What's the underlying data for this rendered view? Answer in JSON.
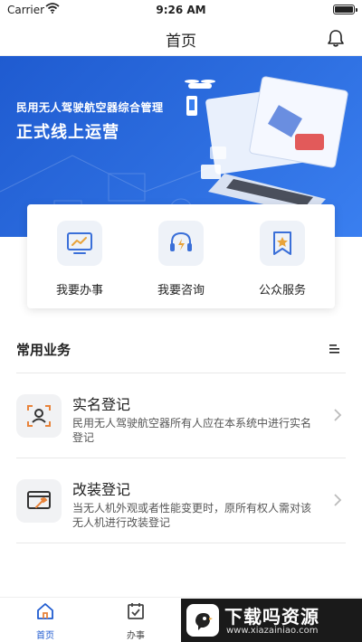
{
  "status_bar": {
    "carrier": "Carrier",
    "time": "9:26 AM"
  },
  "nav": {
    "title": "首页"
  },
  "banner": {
    "subtitle": "民用无人驾驶航空器综合管理",
    "title": "正式线上运营",
    "accent_color": "#1f5bd0"
  },
  "services": [
    {
      "label": "我要办事",
      "icon": "chart-screen-icon"
    },
    {
      "label": "我要咨询",
      "icon": "headset-icon"
    },
    {
      "label": "公众服务",
      "icon": "bookmark-star-icon"
    }
  ],
  "section": {
    "title": "常用业务"
  },
  "business": [
    {
      "name": "实名登记",
      "desc": "民用无人驾驶航空器所有人应在本系统中进行实名登记",
      "icon": "id-scan-icon"
    },
    {
      "name": "改装登记",
      "desc": "当无人机外观或者性能变更时，原所有权人需对该无人机进行改装登记",
      "icon": "window-wrench-icon"
    }
  ],
  "tabs": [
    {
      "label": "首页",
      "icon": "home-icon",
      "active": true
    },
    {
      "label": "办事",
      "icon": "calendar-check-icon",
      "active": false
    }
  ],
  "watermark": {
    "title": "下载吗资源",
    "url": "www.xiazainiao.com"
  }
}
